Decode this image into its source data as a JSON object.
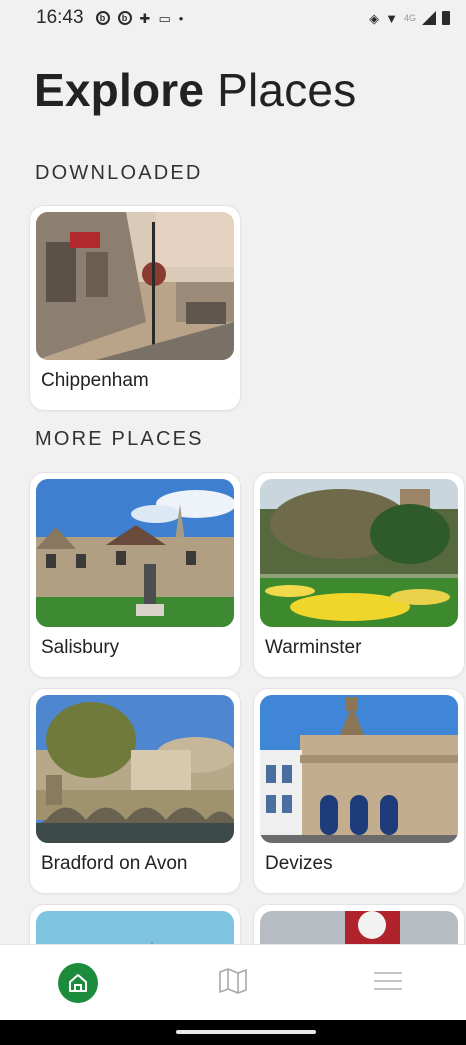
{
  "status_bar": {
    "time": "16:43",
    "network_label": "4G"
  },
  "header": {
    "title_bold": "Explore",
    "title_light": "Places"
  },
  "sections": {
    "downloaded": "DOWNLOADED",
    "more_places": "MORE PLACES"
  },
  "downloaded_places": [
    {
      "name": "Chippenham"
    }
  ],
  "more_places": [
    {
      "name": "Salisbury"
    },
    {
      "name": "Warminster"
    },
    {
      "name": "Bradford on Avon"
    },
    {
      "name": "Devizes"
    }
  ],
  "bottom_nav": {
    "items": [
      {
        "icon": "home-icon",
        "active": true
      },
      {
        "icon": "map-icon",
        "active": false
      },
      {
        "icon": "menu-icon",
        "active": false
      }
    ],
    "accent_color": "#1d8b3c"
  }
}
